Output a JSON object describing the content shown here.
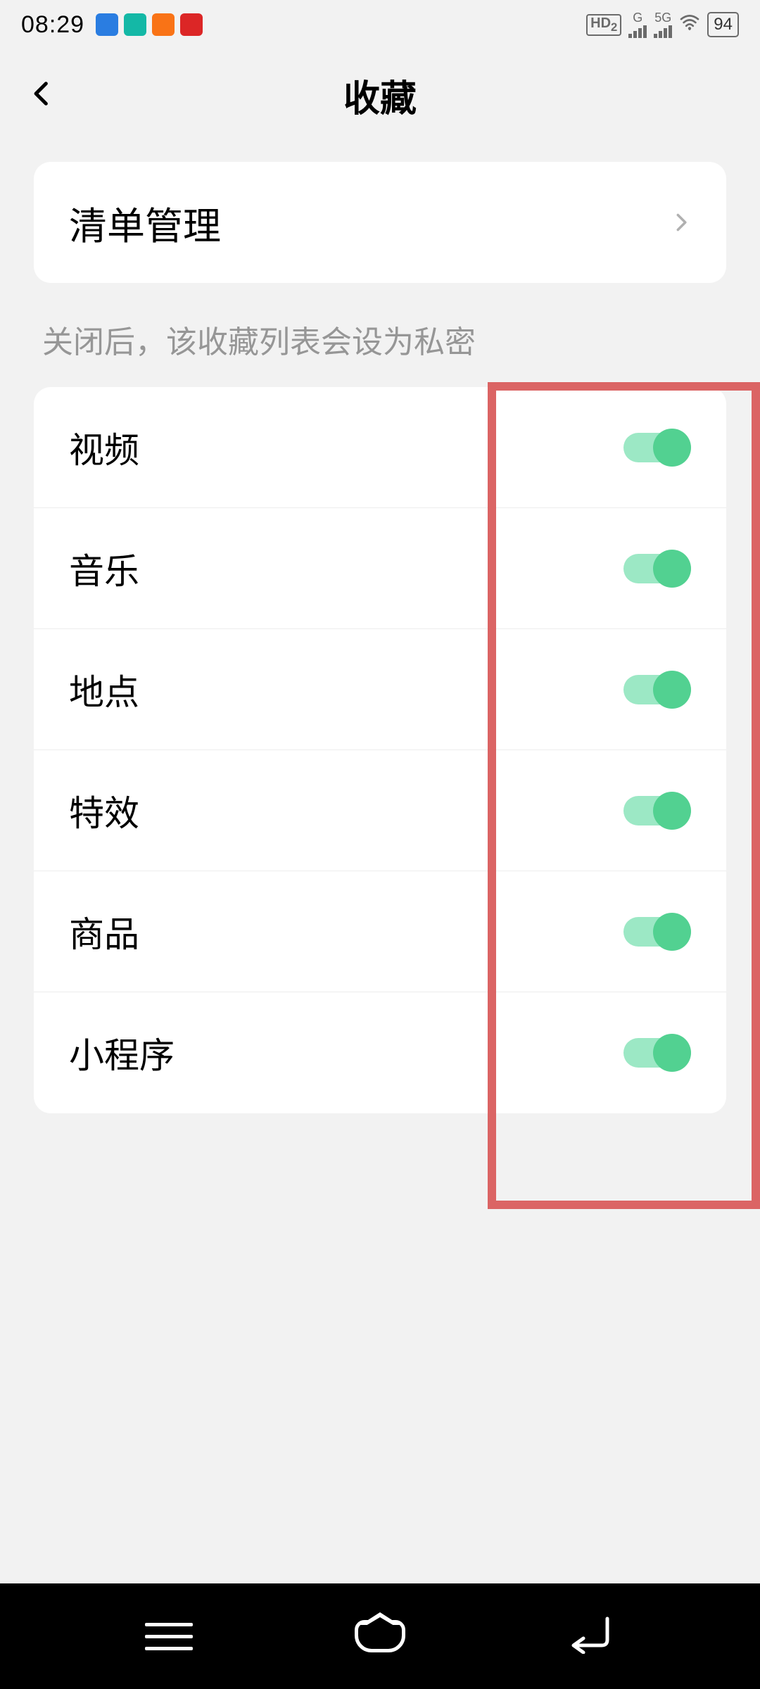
{
  "status_bar": {
    "time": "08:29",
    "hd_label": "HD",
    "hd_sub": "2",
    "net_g": "G",
    "net_5g": "5G",
    "battery": "94"
  },
  "header": {
    "title": "收藏"
  },
  "list_management": {
    "label": "清单管理"
  },
  "section_hint": "关闭后，该收藏列表会设为私密",
  "toggles": [
    {
      "label": "视频",
      "on": true
    },
    {
      "label": "音乐",
      "on": true
    },
    {
      "label": "地点",
      "on": true
    },
    {
      "label": "特效",
      "on": true
    },
    {
      "label": "商品",
      "on": true
    },
    {
      "label": "小程序",
      "on": true
    }
  ]
}
